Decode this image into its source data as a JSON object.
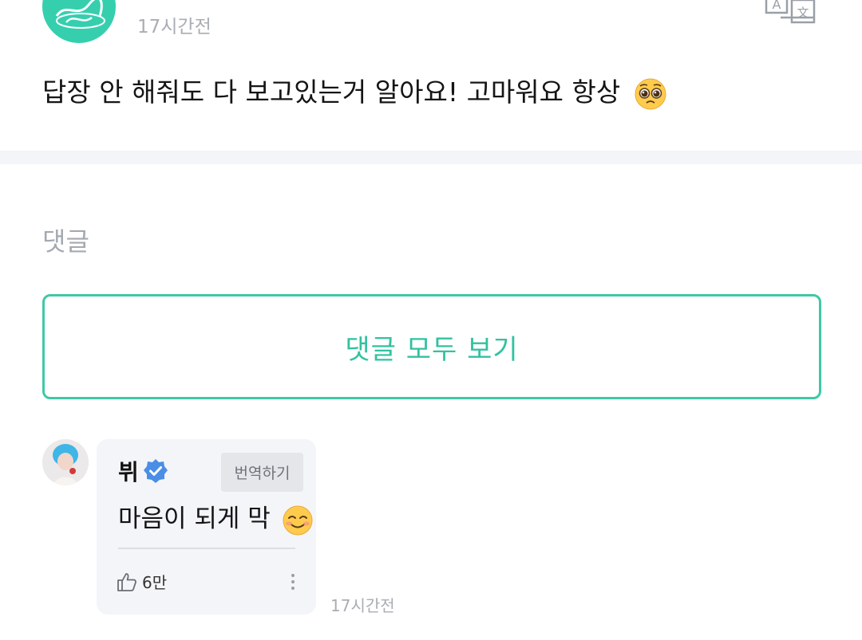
{
  "post": {
    "author": "",
    "time": "17시간전",
    "text": "답장 안 해줘도 다 보고있는거 알아요! 고마워요 항상",
    "text_emoji": "pleading-face-emoji"
  },
  "comments": {
    "heading": "댓글",
    "view_all_label": "댓글 모두 보기",
    "items": [
      {
        "author": "뷔",
        "verified": true,
        "translate_label": "번역하기",
        "text": "마음이 되게 막",
        "text_emoji": "smiling-face-emoji",
        "likes": "6만",
        "time": "17시간전"
      }
    ]
  },
  "colors": {
    "accent": "#31c2a0",
    "verified": "#4a8ee6",
    "muted_text": "#a9adb4",
    "bubble_bg": "#f4f5f8"
  },
  "icons": {
    "translate": "translate-icon",
    "verified": "verified-badge-icon",
    "like": "thumbs-up-icon",
    "more": "more-vertical-icon"
  }
}
